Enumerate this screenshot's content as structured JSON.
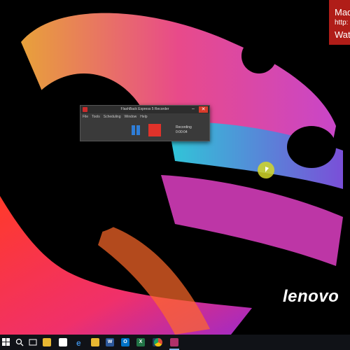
{
  "overlay_text": {
    "line1": "Mad",
    "line2": "http:",
    "line3": "Wat"
  },
  "wallpaper_brand": "lenovo",
  "recorder": {
    "title": "FlashBack Express 5 Recorder",
    "menu": [
      "File",
      "Tools",
      "Scheduling",
      "Window",
      "Help"
    ],
    "status_label": "Recording",
    "elapsed": "0:00:04",
    "pause_color": "#2f7ed8",
    "stop_color": "#e0322a"
  },
  "taskbar": {
    "items": [
      {
        "icon": "start-windows-icon",
        "color": "#ffffff"
      },
      {
        "icon": "search-icon",
        "color": "#ffffff"
      },
      {
        "icon": "task-view-icon",
        "color": "#ffffff"
      },
      {
        "icon": "file-explorer-icon",
        "color": "#e8b732"
      },
      {
        "icon": "store-icon",
        "color": "#ffffff"
      },
      {
        "icon": "photos-icon",
        "color": "#d98a2b"
      },
      {
        "icon": "edge-icon",
        "color": "#3c8ad8"
      },
      {
        "icon": "folder-icon",
        "color": "#e8b732"
      },
      {
        "icon": "word-icon",
        "color": "#2b579a"
      },
      {
        "icon": "outlook-icon",
        "color": "#0072c6"
      },
      {
        "icon": "excel-icon",
        "color": "#217346"
      },
      {
        "icon": "photoshop-icon",
        "color": "#1f3c5c"
      },
      {
        "icon": "chrome-icon",
        "color": "#dd4b39"
      },
      {
        "icon": "snipping-tool-icon",
        "color": "#c0392b"
      },
      {
        "icon": "flashback-recorder-icon",
        "color": "#b0306a"
      }
    ]
  }
}
